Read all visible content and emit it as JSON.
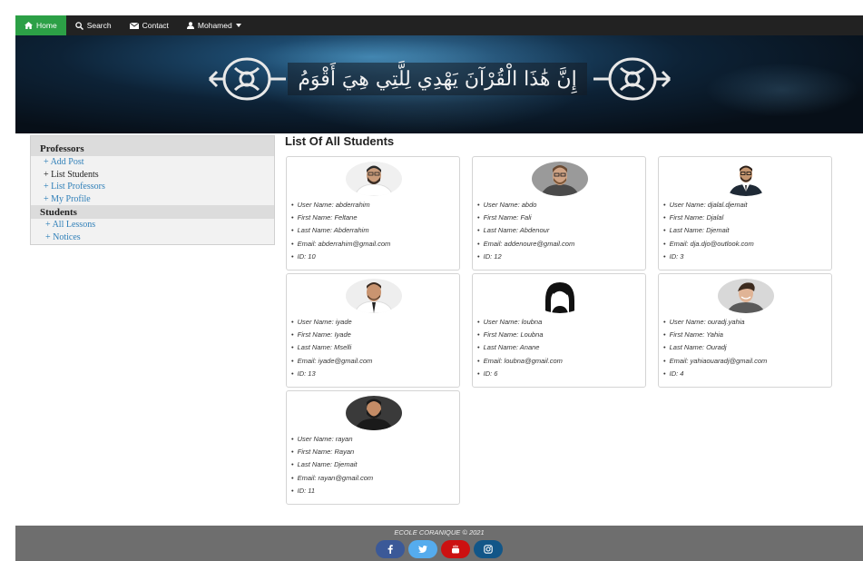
{
  "nav": {
    "items": [
      {
        "label": "Home",
        "icon": "home-icon"
      },
      {
        "label": "Search",
        "icon": "search-icon"
      },
      {
        "label": "Contact",
        "icon": "envelope-icon"
      },
      {
        "label": "Mohamed",
        "icon": "user-icon"
      }
    ],
    "active_color": "#2ca046",
    "bar_color": "#222222"
  },
  "banner": {
    "verse": "إِنَّ هَٰذَا الْقُرْآنَ يَهْدِي لِلَّتِي هِيَ أَقْوَمُ"
  },
  "sidebar": {
    "professors_heading": "Professors",
    "professor_links": [
      "+ Add Post",
      "+ List Students",
      "+ List Professors",
      "+ My Profile"
    ],
    "students_heading": "Students",
    "student_links": [
      "+ All Lessons",
      "+ Notices"
    ]
  },
  "main": {
    "title": "List Of All Students",
    "students": [
      {
        "user_name": "User Name: abderrahim",
        "first_name": "First Name: Feltane",
        "last_name": "Last Name: Abderrahim",
        "email": "Email: abderrahim@gmail.com",
        "id": "ID: 10",
        "avatar": "avatar-man-beard-white"
      },
      {
        "user_name": "User Name: abdo",
        "first_name": "First Name: Fali",
        "last_name": "Last Name: Abdenour",
        "email": "Email: addenoure@gmail.com",
        "id": "ID: 12",
        "avatar": "avatar-man-glasses-grey"
      },
      {
        "user_name": "User Name: djalal.djemait",
        "first_name": "First Name: Djalal",
        "last_name": "Last Name: Djemait",
        "email": "Email: dja.djo@outlook.com",
        "id": "ID: 3",
        "avatar": "avatar-man-suit"
      },
      {
        "user_name": "User Name: iyade",
        "first_name": "First Name: Iyade",
        "last_name": "Last Name: Mselli",
        "email": "Email: iyade@gmail.com",
        "id": "ID: 13",
        "avatar": "avatar-man-tie"
      },
      {
        "user_name": "User Name: loubna",
        "first_name": "First Name: Loubna",
        "last_name": "Last Name: Anane",
        "email": "Email: loubna@gmail.com",
        "id": "ID: 6",
        "avatar": "avatar-woman-silhouette"
      },
      {
        "user_name": "User Name: ouradj.yahia",
        "first_name": "First Name: Yahia",
        "last_name": "Last Name: Ouradj",
        "email": "Email: yahiaouaradj@gmail.com",
        "id": "ID: 4",
        "avatar": "avatar-man-smiling"
      },
      {
        "user_name": "User Name: rayan",
        "first_name": "First Name: Rayan",
        "last_name": "Last Name: Djemait",
        "email": "Email: rayan@gmail.com",
        "id": "ID: 11",
        "avatar": "avatar-man-dark-beard"
      }
    ]
  },
  "footer": {
    "text": "ECOLE CORANIQUE © 2021",
    "social": [
      {
        "icon": "facebook-icon",
        "color": "#3b5998"
      },
      {
        "icon": "twitter-icon",
        "color": "#55acee"
      },
      {
        "icon": "youtube-icon",
        "color": "#cc1111"
      },
      {
        "icon": "instagram-icon",
        "color": "#125688"
      }
    ]
  }
}
